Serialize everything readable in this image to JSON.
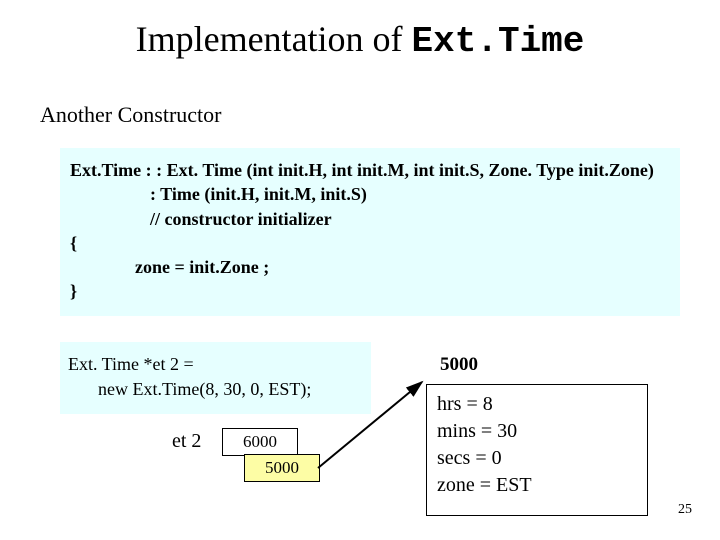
{
  "title": {
    "prefix": "Implementation of ",
    "mono": "Ext.Time"
  },
  "subtitle": "Another Constructor",
  "code": {
    "l1": "Ext.Time : : Ext. Time (int init.H, int init.M, int init.S, Zone. Type init.Zone)",
    "l2": ": Time (init.H, init.M, init.S)",
    "l3": "// constructor initializer",
    "l4": "{",
    "l5": "zone  = init.Zone ;",
    "l6": "}"
  },
  "snippet": {
    "l1": "Ext. Time *et 2 =",
    "l2": "new Ext.Time(8, 30, 0, EST);"
  },
  "et2_label": "et 2",
  "ptr_value": "6000",
  "val_value": "5000",
  "addr_label": "5000",
  "result": {
    "l1": "hrs = 8",
    "l2": "mins = 30",
    "l3": "secs = 0",
    "l4": "zone = EST"
  },
  "page_number": "25"
}
